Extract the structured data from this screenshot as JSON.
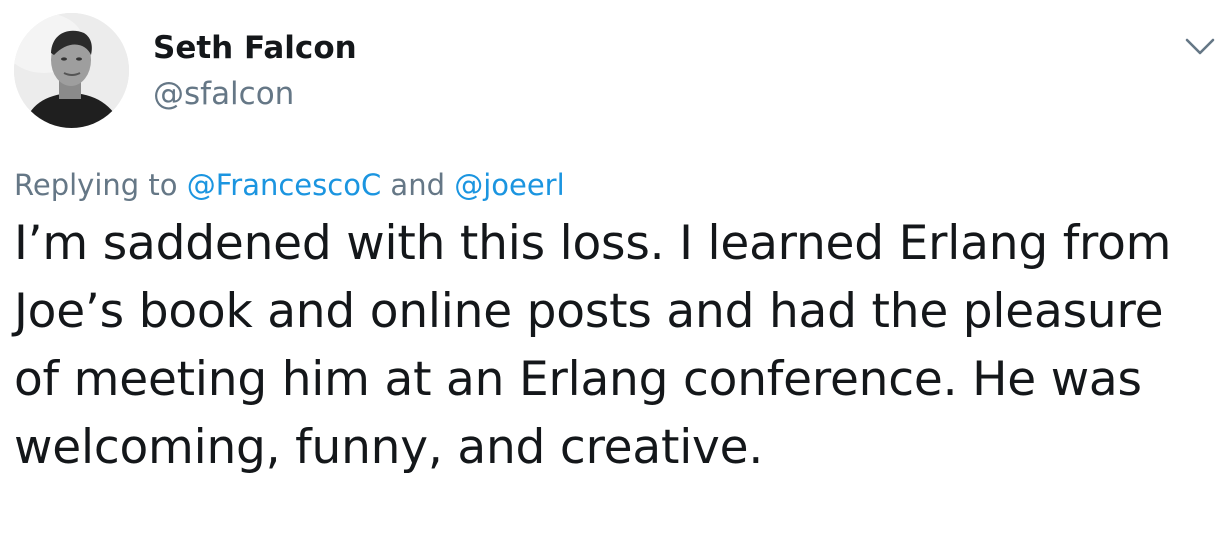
{
  "author": {
    "display_name": "Seth Falcon",
    "handle": "@sfalcon"
  },
  "header": {
    "menu_icon": "chevron-down-icon"
  },
  "reply": {
    "prefix": "Replying to ",
    "mention_1": "@FrancescoC",
    "conjunction": " and ",
    "mention_2": "@joeerl"
  },
  "tweet": {
    "text": "I’m saddened with this loss. I learned Erlang from Joe’s book and online posts and had the pleasure of meeting him at an Erlang conference. He was welcoming, funny, and creative."
  },
  "colors": {
    "name": "#14171a",
    "secondary": "#657786",
    "link": "#1b95e0"
  }
}
